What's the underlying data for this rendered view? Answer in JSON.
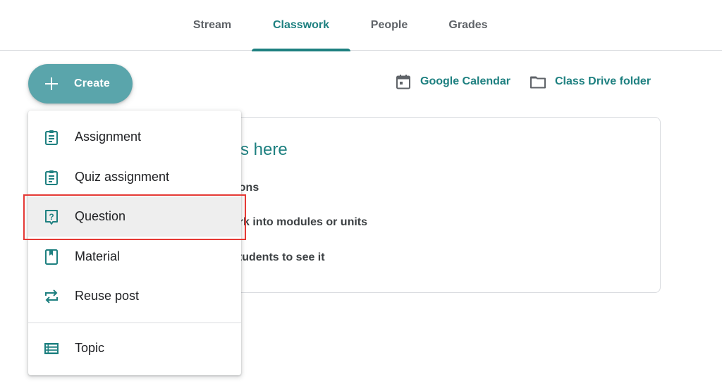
{
  "tabs": [
    {
      "label": "Stream",
      "active": false
    },
    {
      "label": "Classwork",
      "active": true
    },
    {
      "label": "People",
      "active": false
    },
    {
      "label": "Grades",
      "active": false
    }
  ],
  "create_button": {
    "label": "Create",
    "icon": "plus-icon"
  },
  "links": {
    "calendar": {
      "label": "Google Calendar",
      "icon": "calendar-icon"
    },
    "drive": {
      "label": "Class Drive folder",
      "icon": "folder-icon"
    }
  },
  "card": {
    "title": "ss here",
    "lines": [
      "tions",
      "ork into modules or units",
      "students to see it"
    ]
  },
  "menu": {
    "items": [
      {
        "label": "Assignment",
        "icon": "assignment-icon"
      },
      {
        "label": "Quiz assignment",
        "icon": "quiz-assignment-icon"
      },
      {
        "label": "Question",
        "icon": "question-icon",
        "highlighted": true
      },
      {
        "label": "Material",
        "icon": "material-icon"
      },
      {
        "label": "Reuse post",
        "icon": "reuse-post-icon"
      },
      {
        "label": "Topic",
        "icon": "topic-icon"
      }
    ]
  },
  "colors": {
    "accent": "#1e8080",
    "create_button": "#5aa5ab",
    "highlight_border": "#e53935",
    "hover_bg": "#eeeeee"
  }
}
